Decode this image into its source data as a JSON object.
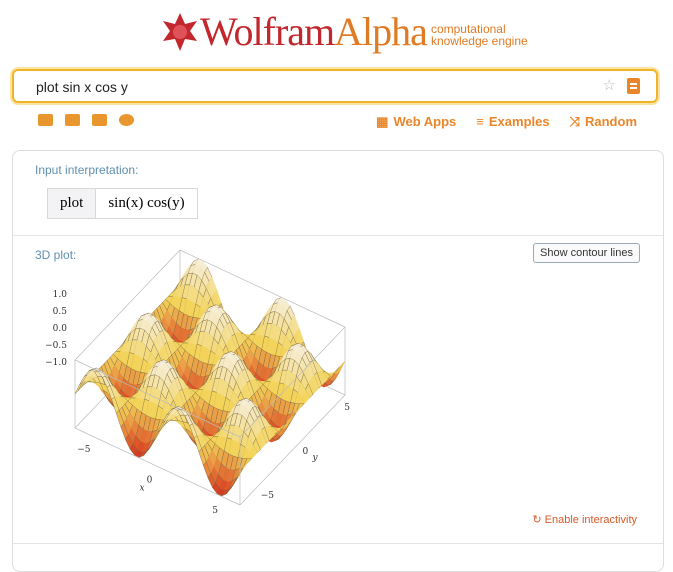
{
  "logo": {
    "wolfram": "Wolfram",
    "alpha": "Alpha",
    "tagline1": "computational",
    "tagline2": "knowledge engine"
  },
  "search": {
    "value": "plot sin x cos y"
  },
  "nav": {
    "web_apps": "Web Apps",
    "examples": "Examples",
    "random": "Random"
  },
  "pods": {
    "input": {
      "title": "Input interpretation:",
      "keyword": "plot",
      "expr": "sin(x) cos(y)"
    },
    "plot": {
      "title": "3D plot:",
      "contour_button": "Show contour lines",
      "interactivity": "Enable interactivity"
    }
  },
  "plot3d": {
    "function": "sin(x) cos(y)",
    "x_range": [
      -6.283,
      6.283
    ],
    "y_range": [
      -6.283,
      6.283
    ],
    "z_range": [
      -1,
      1
    ],
    "z_ticks": [
      "1.0",
      "0.5",
      "0.0",
      "−0.5",
      "−1.0"
    ],
    "x_ticks": [
      "−5",
      "0",
      "5"
    ],
    "y_ticks": [
      "−5",
      "0",
      "5"
    ],
    "x_label": "x",
    "y_label": "y",
    "colors": {
      "high": "#f6eed8",
      "mid": "#f3d35a",
      "low": "#d9391e"
    }
  },
  "colors": {
    "accent": "#e9862a",
    "brand_red": "#c1272d",
    "search_border": "#f0b429"
  }
}
